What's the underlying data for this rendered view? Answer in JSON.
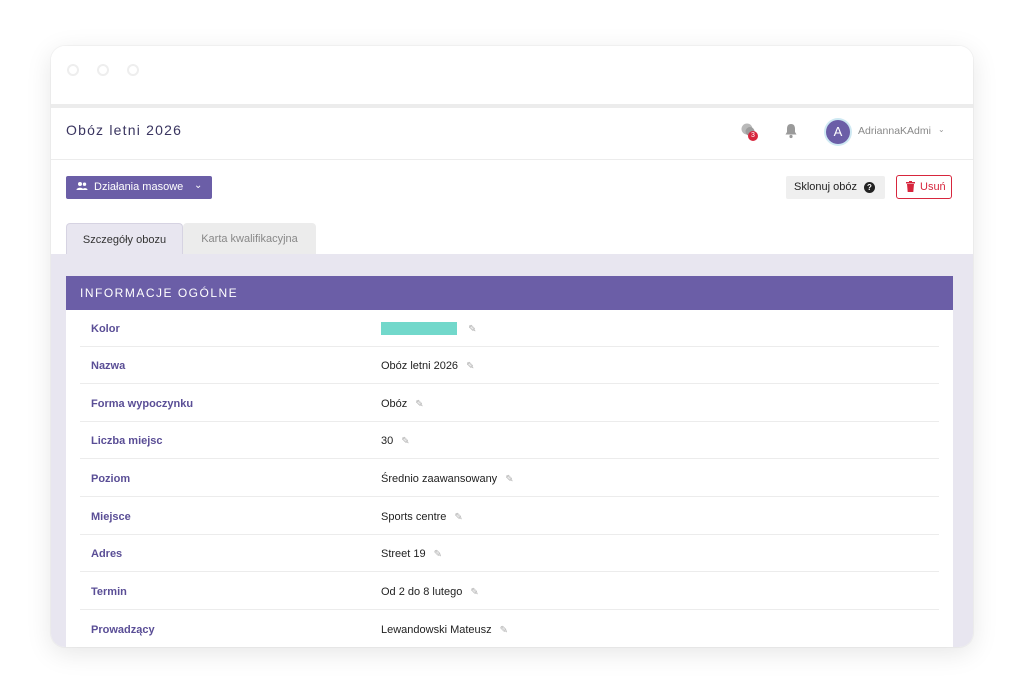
{
  "header": {
    "title": "Obóz letni 2026",
    "notifications_badge": "3",
    "username": "AdriannaKAdmi",
    "avatar_initial": "A"
  },
  "toolbar": {
    "mass_actions_label": "Działania masowe",
    "clone_label": "Sklonuj obóz",
    "delete_label": "Usuń"
  },
  "tabs": [
    {
      "label": "Szczegóły obozu",
      "active": true
    },
    {
      "label": "Karta kwalifikacyjna",
      "active": false
    }
  ],
  "section": {
    "title": "INFORMACJE OGÓLNE",
    "rows": [
      {
        "label": "Kolor",
        "value": "",
        "color": "#72d8cb"
      },
      {
        "label": "Nazwa",
        "value": "Obóz letni 2026"
      },
      {
        "label": "Forma wypoczynku",
        "value": "Obóz"
      },
      {
        "label": "Liczba miejsc",
        "value": "30"
      },
      {
        "label": "Poziom",
        "value": "Średnio zaawansowany"
      },
      {
        "label": "Miejsce",
        "value": "Sports centre"
      },
      {
        "label": "Adres",
        "value": "Street 19"
      },
      {
        "label": "Termin",
        "value": "Od 2 do 8 lutego"
      },
      {
        "label": "Prowadzący",
        "value": "Lewandowski Mateusz"
      }
    ]
  },
  "colors": {
    "accent": "#6b5ea7",
    "danger": "#d7263d",
    "content_bg": "#e8e6f0"
  },
  "icons": [
    "users-icon",
    "chevron-down-icon",
    "question-icon",
    "trash-icon",
    "chat-icon",
    "bell-icon",
    "pencil-icon"
  ]
}
